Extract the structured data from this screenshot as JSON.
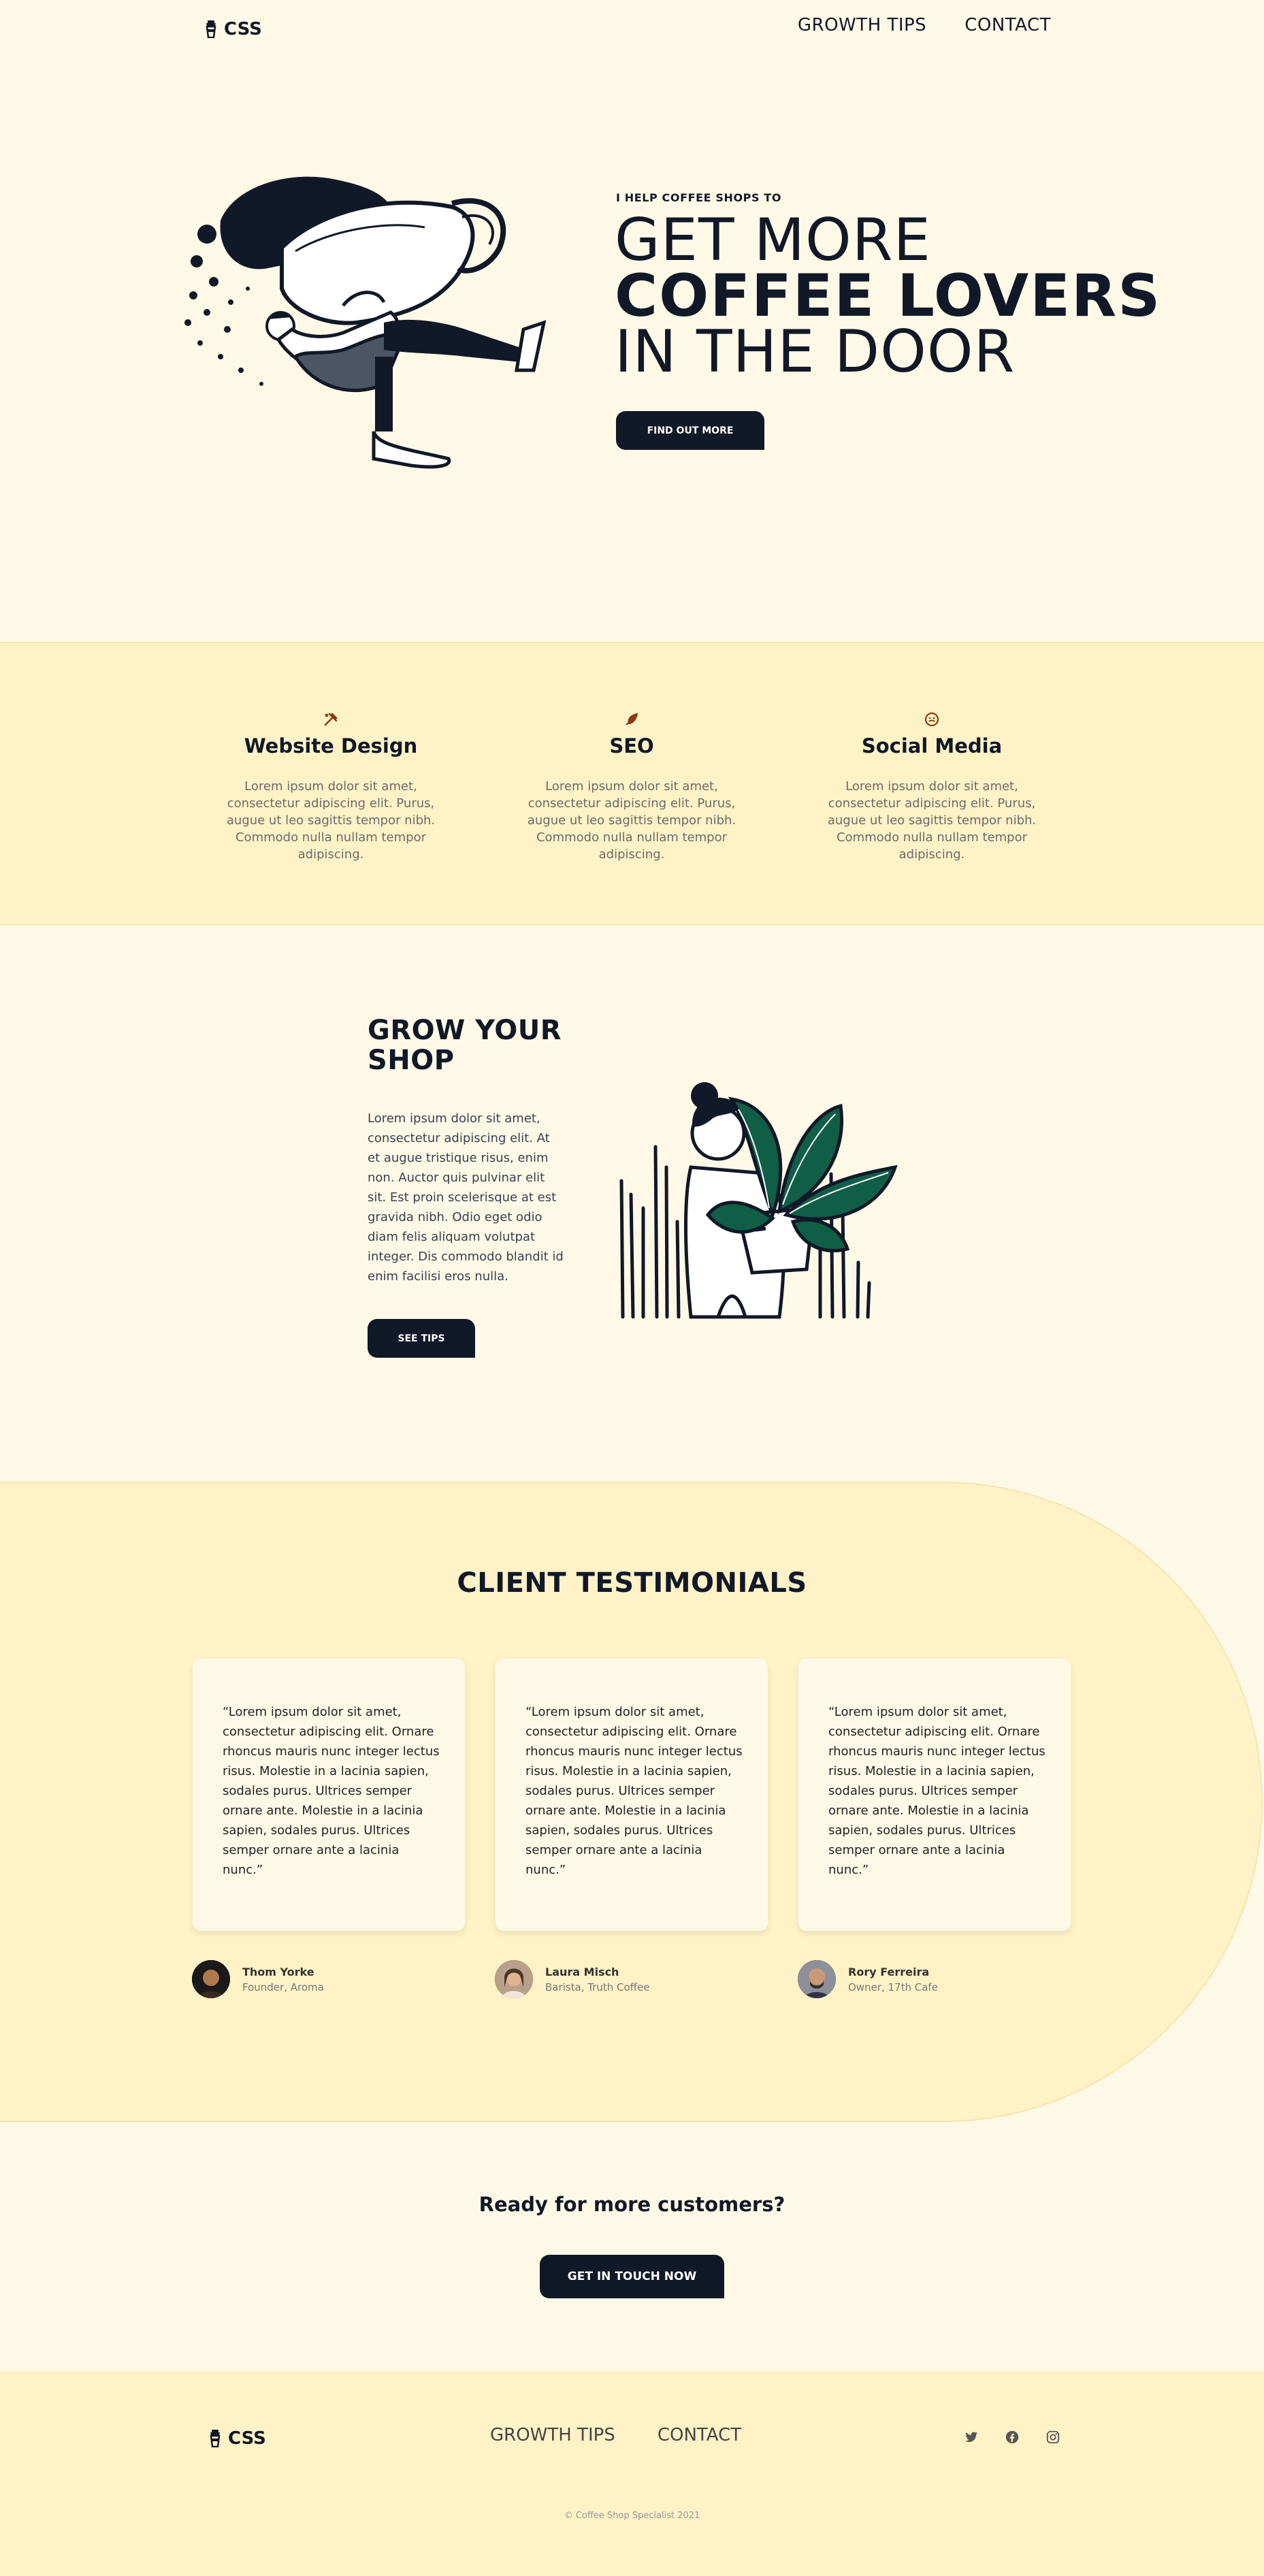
{
  "nav": {
    "logo_text": "CSS",
    "links": [
      "GROWTH TIPS",
      "CONTACT"
    ]
  },
  "hero": {
    "eyebrow": "I HELP COFFEE SHOPS TO",
    "line1": "GET MORE",
    "line2": "COFFEE LOVERS",
    "line3": "IN THE DOOR",
    "button": "FIND OUT MORE"
  },
  "services": [
    {
      "icon": "pen-tool-icon",
      "title": "Website Design",
      "text": "Lorem ipsum dolor sit amet, consectetur adipiscing elit. Purus, augue ut leo sagittis tempor nibh. Commodo nulla nullam tempor adipiscing."
    },
    {
      "icon": "feather-icon",
      "title": "SEO",
      "text": "Lorem ipsum dolor sit amet, consectetur adipiscing elit. Purus, augue ut leo sagittis tempor nibh. Commodo nulla nullam tempor adipiscing."
    },
    {
      "icon": "smiley-icon",
      "title": "Social Media",
      "text": "Lorem ipsum dolor sit amet, consectetur adipiscing elit. Purus, augue ut leo sagittis tempor nibh. Commodo nulla nullam tempor adipiscing."
    }
  ],
  "grow": {
    "title_line1": "GROW YOUR",
    "title_line2": "SHOP",
    "text": "Lorem ipsum dolor sit amet, consectetur adipiscing elit. At et augue tristique risus, enim non. Auctor quis pulvinar elit sit. Est proin scelerisque at est gravida nibh. Odio eget odio diam felis aliquam volutpat integer. Dis commodo blandit id enim facilisi eros nulla.",
    "button": "SEE TIPS"
  },
  "testimonials": {
    "title": "CLIENT TESTIMONIALS",
    "items": [
      {
        "quote": "“Lorem ipsum dolor sit amet, consectetur adipiscing elit. Ornare rhoncus mauris nunc integer lectus risus. Molestie in a lacinia sapien, sodales purus. Ultrices semper ornare ante. Molestie in a lacinia sapien, sodales purus. Ultrices semper ornare ante a lacinia nunc.”",
        "name": "Thom Yorke",
        "role": "Founder, Aroma"
      },
      {
        "quote": "“Lorem ipsum dolor sit amet, consectetur adipiscing elit. Ornare rhoncus mauris nunc integer lectus risus. Molestie in a lacinia sapien, sodales purus. Ultrices semper ornare ante. Molestie in a lacinia sapien, sodales purus. Ultrices semper ornare ante a lacinia nunc.”",
        "name": "Laura Misch",
        "role": "Barista, Truth Coffee"
      },
      {
        "quote": "“Lorem ipsum dolor sit amet, consectetur adipiscing elit. Ornare rhoncus mauris nunc integer lectus risus. Molestie in a lacinia sapien, sodales purus. Ultrices semper ornare ante. Molestie in a lacinia sapien, sodales purus. Ultrices semper ornare ante a lacinia nunc.”",
        "name": "Rory Ferreira",
        "role": "Owner, 17th Cafe"
      }
    ]
  },
  "cta": {
    "title": "Ready for more customers?",
    "button": "GET IN TOUCH NOW"
  },
  "footer": {
    "logo_text": "CSS",
    "links": [
      "GROWTH TIPS",
      "CONTACT"
    ],
    "social": [
      "twitter-icon",
      "facebook-icon",
      "instagram-icon"
    ],
    "copyright": "© Coffee Shop Specialist 2021"
  },
  "colors": {
    "background": "#fef9e7",
    "band": "#fef2c6",
    "dark": "#111827",
    "accent": "#8a3b12",
    "plant": "#0f5e45"
  }
}
